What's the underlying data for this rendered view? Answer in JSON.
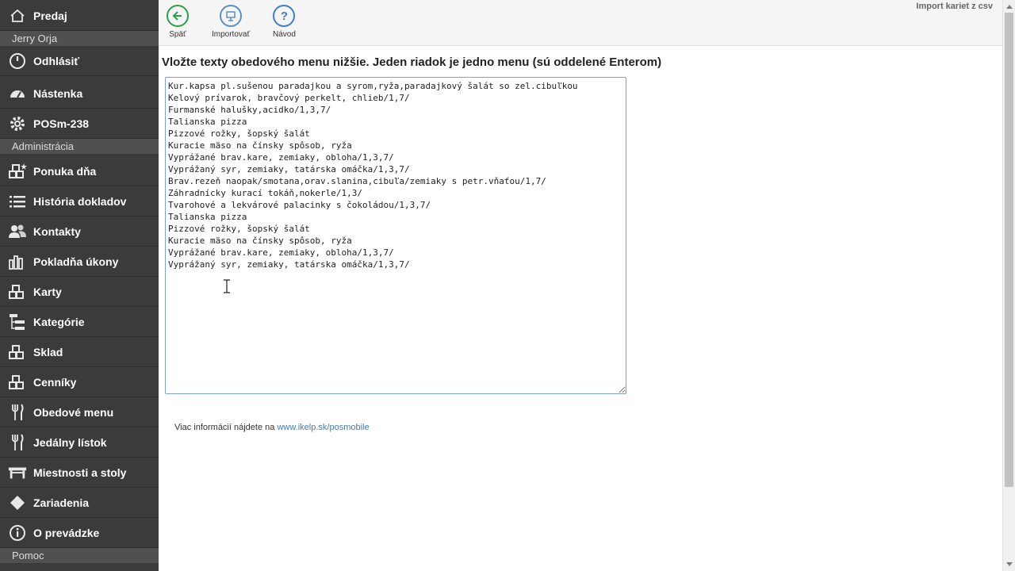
{
  "sidebar": {
    "top_item": "Predaj",
    "user_name": "Jerry Orja",
    "logout": "Odhlásiť",
    "dashboard": "Nástenka",
    "device": "POSm-238",
    "section_admin": "Administrácia",
    "items": [
      {
        "label": "Ponuka dňa",
        "icon": "boxes-star-icon"
      },
      {
        "label": "História dokladov",
        "icon": "list-icon"
      },
      {
        "label": "Kontakty",
        "icon": "users-icon"
      },
      {
        "label": "Pokladňa úkony",
        "icon": "bar-chart-icon"
      },
      {
        "label": "Karty",
        "icon": "boxes-icon"
      },
      {
        "label": "Kategórie",
        "icon": "tree-icon"
      },
      {
        "label": "Sklad",
        "icon": "boxes-icon"
      },
      {
        "label": "Cenníky",
        "icon": "boxes-icon"
      },
      {
        "label": "Obedové menu",
        "icon": "cutlery-icon"
      },
      {
        "label": "Jedálny lístok",
        "icon": "cutlery-icon"
      },
      {
        "label": "Miestnosti a stoly",
        "icon": "table-icon"
      },
      {
        "label": "Zariadenia",
        "icon": "diamond-icon"
      },
      {
        "label": "O prevádzke",
        "icon": "info-icon"
      }
    ],
    "section_help": "Pomoc"
  },
  "toolbar": {
    "back_label": "Späť",
    "import_label": "Importovať",
    "guide_label": "Návod",
    "import_csv": "Import kariet z csv"
  },
  "main": {
    "heading": "Vložte texty obedového menu nižšie. Jeden riadok je jedno menu (sú oddelené Enterom)",
    "menu_text": "Kur.kapsa pl.sušenou paradajkou a syrom,ryža,paradajkový šalát so zel.cibuľkou\nKelový prívarok, bravčový perkelt, chlieb/1,7/\nFurmanské halušky,acidko/1,3,7/\nTalianska pizza\nPizzové rožky, šopský šalát\nKuracie mäso na čínsky spôsob, ryža\nVyprážané brav.kare, zemiaky, obloha/1,3,7/\nVyprážaný syr, zemiaky, tatárska omáčka/1,3,7/\nBrav.rezeň naopak/smotana,orav.slanina,cibuľa/zemiaky s petr.vňaťou/1,7/\nZáhradnícky kurací tokáň,nokerle/1,3/\nTvarohové a lekvárové palacinky s čokoládou/1,3,7/\nTalianska pizza\nPizzové rožky, šopský šalát\nKuracie mäso na čínsky spôsob, ryža\nVyprážané brav.kare, zemiaky, obloha/1,3,7/\nVyprážaný syr, zemiaky, tatárska omáčka/1,3,7/\n",
    "footer_text": "Viac informácií nájdete na ",
    "footer_link": "www.ikelp.sk/posmobile"
  },
  "colors": {
    "sidebar_bg": "#3b3b3b",
    "section_bg": "#505050",
    "back_green": "#2e9e4a",
    "import_blue": "#5b8fc7",
    "guide_blue": "#3f7fc9",
    "link_blue": "#4a7ab0"
  }
}
